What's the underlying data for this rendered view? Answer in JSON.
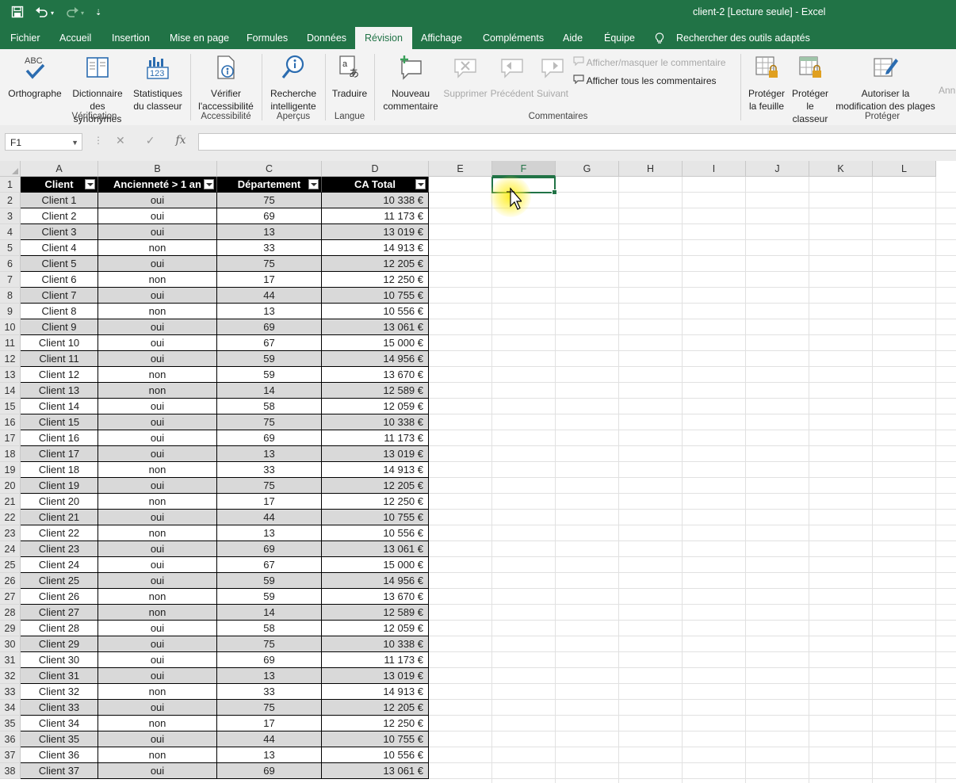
{
  "window": {
    "title": "client-2  [Lecture seule]  -  Excel"
  },
  "qat": {
    "save_icon": "save-icon",
    "undo_icon": "undo-icon",
    "redo_icon": "redo-icon"
  },
  "menu": {
    "tabs": [
      "Fichier",
      "Accueil",
      "Insertion",
      "Mise en page",
      "Formules",
      "Données",
      "Révision",
      "Affichage",
      "Compléments",
      "Aide",
      "Équipe"
    ],
    "active": "Révision",
    "search": "Rechercher des outils adaptés"
  },
  "ribbon": {
    "orthographe": "Orthographe",
    "dictionnaire": [
      "Dictionnaire",
      "des synonymes"
    ],
    "statistiques": [
      "Statistiques",
      "du classeur"
    ],
    "verifier": [
      "Vérifier",
      "l'accessibilité"
    ],
    "recherche": [
      "Recherche",
      "intelligente"
    ],
    "traduire": "Traduire",
    "nouveau": [
      "Nouveau",
      "commentaire"
    ],
    "supprimer": "Supprimer",
    "precedent": "Précédent",
    "suivant": "Suivant",
    "afficher_masquer": "Afficher/masquer le commentaire",
    "afficher_tous": "Afficher tous les commentaires",
    "proteger_feuille": [
      "Protéger",
      "la feuille"
    ],
    "proteger_classeur": [
      "Protéger",
      "le classeur"
    ],
    "autoriser": [
      "Autoriser la",
      "modification des plages"
    ],
    "annuler": "Ann",
    "groups": {
      "verification": "Vérification",
      "accessibilite": "Accessibilité",
      "apercus": "Aperçus",
      "langue": "Langue",
      "commentaires": "Commentaires",
      "proteger": "Protéger"
    }
  },
  "formula_bar": {
    "name_box": "F1",
    "fx": "fx",
    "content": ""
  },
  "columns": [
    "A",
    "B",
    "C",
    "D",
    "E",
    "F",
    "G",
    "H",
    "I",
    "J",
    "K",
    "L"
  ],
  "table": {
    "headers": [
      "Client",
      "Ancienneté > 1 an",
      "Département",
      "CA Total"
    ],
    "rows": [
      [
        "Client 1",
        "oui",
        "75",
        "10 338 €"
      ],
      [
        "Client 2",
        "oui",
        "69",
        "11 173 €"
      ],
      [
        "Client 3",
        "oui",
        "13",
        "13 019 €"
      ],
      [
        "Client 4",
        "non",
        "33",
        "14 913 €"
      ],
      [
        "Client 5",
        "oui",
        "75",
        "12 205 €"
      ],
      [
        "Client 6",
        "non",
        "17",
        "12 250 €"
      ],
      [
        "Client 7",
        "oui",
        "44",
        "10 755 €"
      ],
      [
        "Client 8",
        "non",
        "13",
        "10 556 €"
      ],
      [
        "Client 9",
        "oui",
        "69",
        "13 061 €"
      ],
      [
        "Client 10",
        "oui",
        "67",
        "15 000 €"
      ],
      [
        "Client 11",
        "oui",
        "59",
        "14 956 €"
      ],
      [
        "Client 12",
        "non",
        "59",
        "13 670 €"
      ],
      [
        "Client 13",
        "non",
        "14",
        "12 589 €"
      ],
      [
        "Client 14",
        "oui",
        "58",
        "12 059 €"
      ],
      [
        "Client 15",
        "oui",
        "75",
        "10 338 €"
      ],
      [
        "Client 16",
        "oui",
        "69",
        "11 173 €"
      ],
      [
        "Client 17",
        "oui",
        "13",
        "13 019 €"
      ],
      [
        "Client 18",
        "non",
        "33",
        "14 913 €"
      ],
      [
        "Client 19",
        "oui",
        "75",
        "12 205 €"
      ],
      [
        "Client 20",
        "non",
        "17",
        "12 250 €"
      ],
      [
        "Client 21",
        "oui",
        "44",
        "10 755 €"
      ],
      [
        "Client 22",
        "non",
        "13",
        "10 556 €"
      ],
      [
        "Client 23",
        "oui",
        "69",
        "13 061 €"
      ],
      [
        "Client 24",
        "oui",
        "67",
        "15 000 €"
      ],
      [
        "Client 25",
        "oui",
        "59",
        "14 956 €"
      ],
      [
        "Client 26",
        "non",
        "59",
        "13 670 €"
      ],
      [
        "Client 27",
        "non",
        "14",
        "12 589 €"
      ],
      [
        "Client 28",
        "oui",
        "58",
        "12 059 €"
      ],
      [
        "Client 29",
        "oui",
        "75",
        "10 338 €"
      ],
      [
        "Client 30",
        "oui",
        "69",
        "11 173 €"
      ],
      [
        "Client 31",
        "oui",
        "13",
        "13 019 €"
      ],
      [
        "Client 32",
        "non",
        "33",
        "14 913 €"
      ],
      [
        "Client 33",
        "oui",
        "75",
        "12 205 €"
      ],
      [
        "Client 34",
        "non",
        "17",
        "12 250 €"
      ],
      [
        "Client 35",
        "oui",
        "44",
        "10 755 €"
      ],
      [
        "Client 36",
        "non",
        "13",
        "10 556 €"
      ],
      [
        "Client 37",
        "oui",
        "69",
        "13 061 €"
      ]
    ]
  },
  "colors": {
    "excel_green": "#217346",
    "band_gray": "#d9d9d9",
    "header_black": "#000000"
  }
}
